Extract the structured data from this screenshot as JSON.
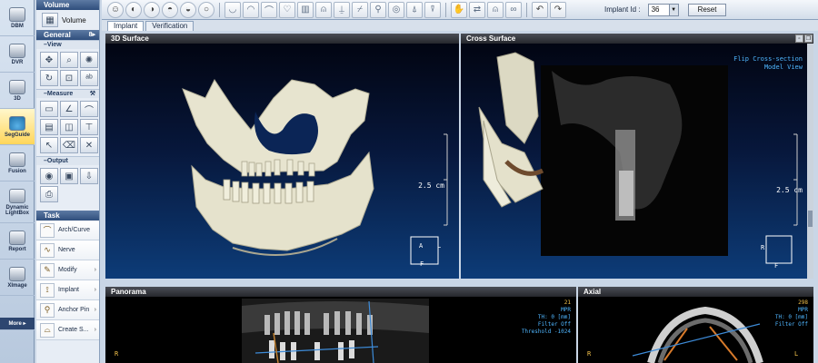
{
  "sidebar": {
    "items": [
      {
        "label": "DBM"
      },
      {
        "label": "DVR"
      },
      {
        "label": "3D"
      },
      {
        "label": "SegGuide"
      },
      {
        "label": "Fusion"
      },
      {
        "label": "Dynamic LightBox"
      },
      {
        "label": "Report"
      },
      {
        "label": "XImage"
      }
    ],
    "more_label": "More ▸"
  },
  "panel": {
    "volume_header": "Volume",
    "volume_button": "Volume",
    "general_header": "General",
    "view_header": "View",
    "measure_header": "Measure",
    "output_header": "Output",
    "task_header": "Task",
    "tasks": [
      {
        "label": "Arch/Curve"
      },
      {
        "label": "Nerve"
      },
      {
        "label": "Modify"
      },
      {
        "label": "Implant"
      },
      {
        "label": "Anchor Pin"
      },
      {
        "label": "Create S..."
      }
    ]
  },
  "toolbar": {
    "implant_label": "Implant Id :",
    "implant_value": "36",
    "reset_label": "Reset"
  },
  "tabs": [
    {
      "label": "Implant"
    },
    {
      "label": "Verification"
    }
  ],
  "viewports": {
    "surface3d": {
      "title": "3D Surface",
      "scale": "2.5 cm"
    },
    "cross": {
      "title": "Cross Surface",
      "flip": "Flip Cross-section",
      "model": "Model View",
      "scale": "2.5 cm"
    },
    "panorama": {
      "title": "Panorama",
      "slice": "21",
      "mode": "MPR",
      "th": "TH: 0 [mm]",
      "filter": "Filter Off",
      "threshold": "Threshold -1024",
      "left_marker": "R"
    },
    "axial": {
      "title": "Axial",
      "slice": "298",
      "mode": "MPR",
      "th": "TH: 0 [mm]",
      "filter": "Filter Off",
      "left_marker": "R",
      "right_marker": "L"
    }
  },
  "colors": {
    "title_bar": "#2f4e7c",
    "info_cyan": "#4fb6ff",
    "info_amber": "#f2c14a",
    "bone": "#e7e4cf"
  }
}
